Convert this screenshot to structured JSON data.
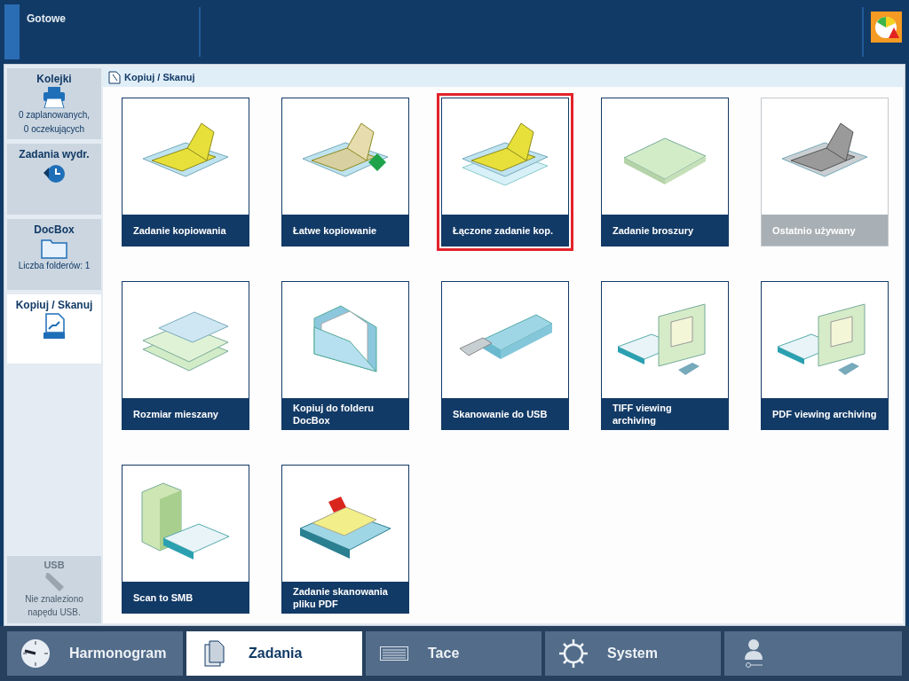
{
  "header": {
    "status": "Gotowe"
  },
  "sidebar": {
    "items": [
      {
        "kind": "queue",
        "title": "Kolejki",
        "lines": [
          "0 zaplanowanych,",
          "0 oczekujących"
        ],
        "selected": false
      },
      {
        "kind": "history",
        "title": "Zadania wydr.",
        "selected": false
      },
      {
        "kind": "docbox",
        "title": "DocBox",
        "lines": [
          "Liczba folderów: 1"
        ],
        "selected": false
      },
      {
        "kind": "copyscan",
        "title": "Kopiuj / Skanuj",
        "selected": true
      }
    ],
    "usb": {
      "title": "USB",
      "lines": [
        "Nie znaleziono",
        "napędu USB."
      ]
    }
  },
  "breadcrumb": "Kopiuj / Skanuj",
  "tiles": [
    {
      "kind": "copy",
      "label": "Zadanie kopiowania",
      "selected": false,
      "disabled": false
    },
    {
      "kind": "easy",
      "label": "Łatwe kopiowanie",
      "selected": false,
      "disabled": false
    },
    {
      "kind": "combined",
      "label": "Łączone zadanie kop.",
      "selected": true,
      "disabled": false
    },
    {
      "kind": "booklet",
      "label": "Zadanie broszury",
      "selected": false,
      "disabled": false
    },
    {
      "kind": "copy",
      "label": "Ostatnio używany",
      "selected": false,
      "disabled": true
    },
    {
      "kind": "mixed",
      "label": "Rozmiar mieszany",
      "selected": false,
      "disabled": false
    },
    {
      "kind": "folder",
      "label": "Kopiuj do folderu DocBox",
      "selected": false,
      "disabled": false
    },
    {
      "kind": "usb",
      "label": "Skanowanie do USB",
      "selected": false,
      "disabled": false
    },
    {
      "kind": "monitor",
      "label": "TIFF viewing archiving",
      "selected": false,
      "disabled": false
    },
    {
      "kind": "monitor",
      "label": "PDF viewing archiving",
      "selected": false,
      "disabled": false
    },
    {
      "kind": "server",
      "label": "Scan to SMB",
      "selected": false,
      "disabled": false
    },
    {
      "kind": "pdf",
      "label": "Zadanie skanowania pliku PDF",
      "selected": false,
      "disabled": false
    }
  ],
  "nav": [
    {
      "kind": "clock",
      "label": "Harmonogram",
      "selected": false
    },
    {
      "kind": "jobs",
      "label": "Zadania",
      "selected": true
    },
    {
      "kind": "trays",
      "label": "Tace",
      "selected": false
    },
    {
      "kind": "system",
      "label": "System",
      "selected": false
    },
    {
      "kind": "user",
      "selected": false
    }
  ]
}
